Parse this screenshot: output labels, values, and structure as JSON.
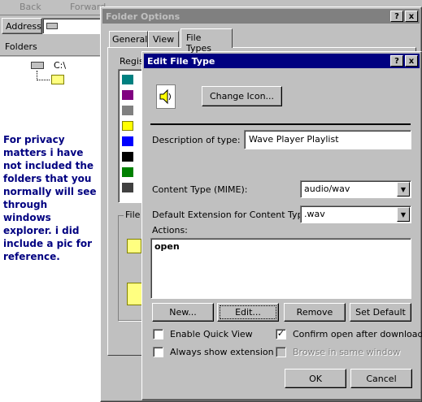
{
  "explorer": {
    "toolbar_back": "Back",
    "toolbar_forward": "Forward",
    "address_label": "Address",
    "folders_title": "Folders",
    "tree_drive": "C:\\",
    "privacy_note": "For privacy matters i have not included the folders that you normally will see through windows explorer. i did include a pic for reference."
  },
  "folder_options": {
    "title": "Folder Options",
    "help_btn": "?",
    "close_btn": "x",
    "tabs": [
      "General",
      "View",
      "File Types"
    ],
    "registered_label": "Regis",
    "file_group_label": "File"
  },
  "edit_file_type": {
    "title": "Edit File Type",
    "help_btn": "?",
    "close_btn": "x",
    "change_icon_label": "Change Icon...",
    "description_label": "Description of type:",
    "description_value": "Wave Player Playlist",
    "content_type_label": "Content Type (MIME):",
    "content_type_value": "audio/wav",
    "default_ext_label": "Default Extension for Content Type:",
    "default_ext_value": ".wav",
    "actions_label": "Actions:",
    "actions": [
      "open"
    ],
    "buttons": {
      "new": "New...",
      "edit": "Edit...",
      "remove": "Remove",
      "set_default": "Set Default"
    },
    "checks": {
      "enable_quick_view": "Enable Quick View",
      "always_show_extension": "Always show extension",
      "confirm_open": "Confirm open after download",
      "browse_same_window": "Browse in same window"
    },
    "ok": "OK",
    "cancel": "Cancel"
  },
  "colors": {
    "title_active": "#000080",
    "title_inactive": "#808080",
    "note_text": "#000080"
  }
}
